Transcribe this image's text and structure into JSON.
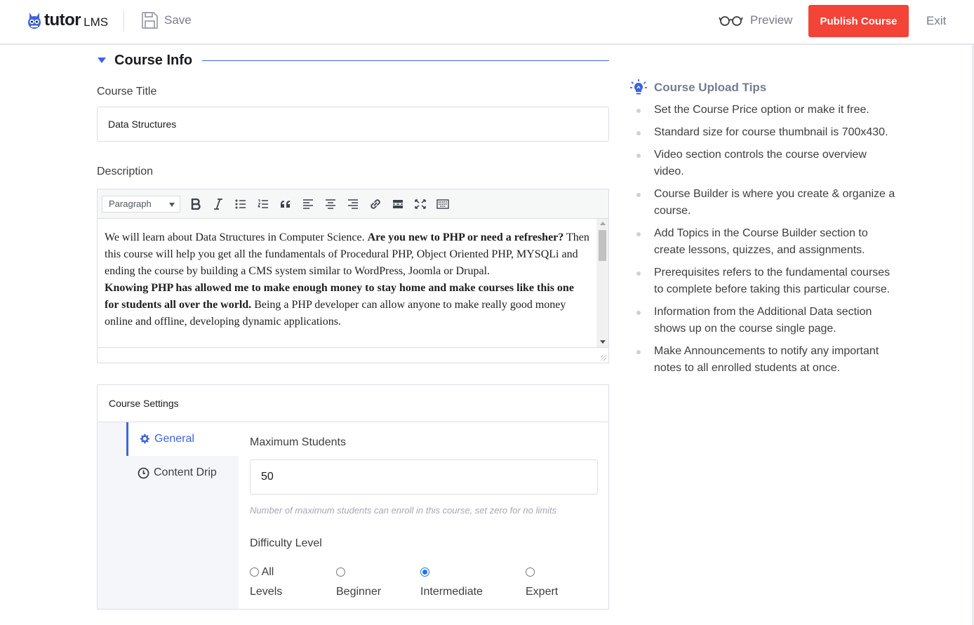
{
  "header": {
    "logo_main": "tutor",
    "logo_sub": "LMS",
    "save_label": "Save",
    "preview_label": "Preview",
    "publish_label": "Publish Course",
    "exit_label": "Exit"
  },
  "course_info": {
    "section_title": "Course Info",
    "title_label": "Course Title",
    "title_value": "Data Structures",
    "description_label": "Description",
    "format_select": "Paragraph"
  },
  "editor": {
    "p1_a": "We will learn about Data Structures in Computer Science. ",
    "p1_b": "Are you new to PHP or need a refresher?",
    "p1_c": " Then this course will help you get all the fundamentals of Procedural PHP, Object Oriented PHP, MYSQLi and ending the course by building a CMS system similar to WordPress, Joomla or Drupal.",
    "p2_a": "Knowing PHP has allowed me to make enough money to stay home and make courses like this one for students all over the world.",
    "p2_b": " Being a PHP developer can allow anyone to make really good money online and offline, developing dynamic applications."
  },
  "settings": {
    "title": "Course Settings",
    "tabs": [
      {
        "label": "General",
        "icon": "gear-icon",
        "active": true
      },
      {
        "label": "Content Drip",
        "icon": "clock-icon",
        "active": false
      }
    ],
    "max_students_label": "Maximum Students",
    "max_students_value": "50",
    "max_students_hint": "Number of maximum students can enroll in this course, set zero for no limits",
    "difficulty_label": "Difficulty Level",
    "difficulty_options": [
      {
        "line1": "All",
        "line2": "Levels",
        "checked": false
      },
      {
        "line1": "",
        "line2": "Beginner",
        "checked": false
      },
      {
        "line1": "",
        "line2": "Intermediate",
        "checked": true
      },
      {
        "line1": "",
        "line2": "Expert",
        "checked": false
      }
    ]
  },
  "tips": {
    "title": "Course Upload Tips",
    "items": [
      "Set the Course Price option or make it free.",
      "Standard size for course thumbnail is 700x430.",
      "Video section controls the course overview video.",
      "Course Builder is where you create & organize a course.",
      "Add Topics in the Course Builder section to create lessons, quizzes, and assignments.",
      "Prerequisites refers to the fundamental courses to complete before taking this particular course.",
      "Information from the Additional Data section shows up on the course single page.",
      "Make Announcements to notify any important notes to all enrolled students at once."
    ]
  },
  "colors": {
    "accent": "#3e64de",
    "publish": "#f44337",
    "muted": "#757c8e"
  }
}
